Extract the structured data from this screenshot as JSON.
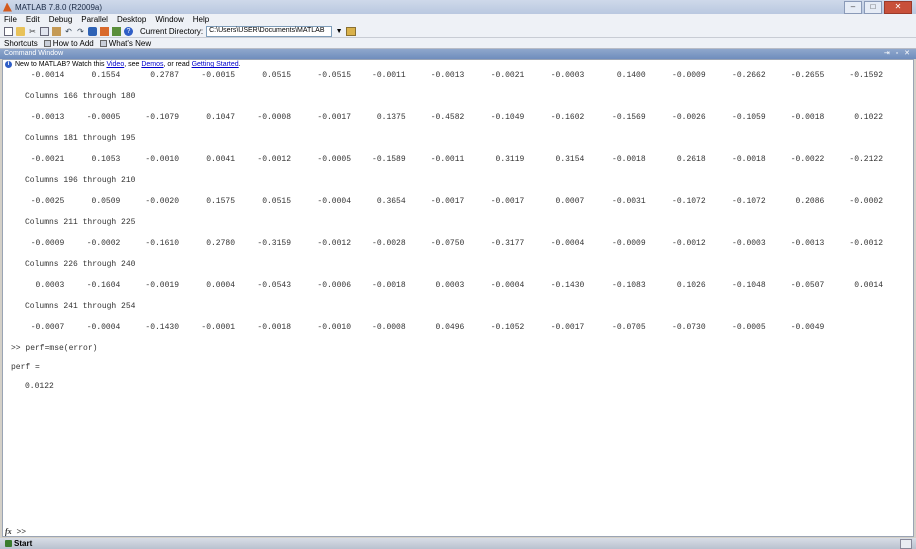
{
  "window": {
    "title": "MATLAB 7.8.0 (R2009a)",
    "minimize": "–",
    "maximize": "□",
    "close": "✕"
  },
  "menu": [
    "File",
    "Edit",
    "Debug",
    "Parallel",
    "Desktop",
    "Window",
    "Help"
  ],
  "toolbar": {
    "icons": [
      "new-file-icon",
      "open-folder-icon",
      "cut-icon",
      "copy-icon",
      "paste-icon",
      "undo-icon",
      "redo-icon",
      "simulink-icon",
      "guide-icon",
      "profiler-icon",
      "help-icon"
    ],
    "current_directory_label": "Current Directory:",
    "current_directory_value": "C:\\Users\\USER\\Documents\\MATLAB"
  },
  "shortcuts": {
    "label": "Shortcuts",
    "items": [
      "How to Add",
      "What's New"
    ]
  },
  "command_window": {
    "title": "Command Window",
    "info": {
      "prefix": "New to MATLAB? Watch this",
      "video": "Video",
      "mid1": ", see",
      "demos": "Demos",
      "mid2": ", or read",
      "getting_started": "Getting Started",
      "suffix": "."
    },
    "first_row": [
      "-0.0014",
      "0.1554",
      "0.2787",
      "-0.0015",
      "0.0515",
      "-0.0515",
      "-0.0011",
      "-0.0013",
      "-0.0021",
      "-0.0003",
      "0.1400",
      "-0.0009",
      "-0.2662",
      "-0.2655",
      "-0.1592"
    ],
    "blocks": [
      {
        "header": "Columns 166 through 180",
        "values": [
          "-0.0013",
          "-0.0005",
          "-0.1079",
          "0.1047",
          "-0.0008",
          "-0.0017",
          "0.1375",
          "-0.4582",
          "-0.1049",
          "-0.1602",
          "-0.1569",
          "-0.0026",
          "-0.1059",
          "-0.0018",
          "0.1022"
        ]
      },
      {
        "header": "Columns 181 through 195",
        "values": [
          "-0.0021",
          "0.1053",
          "-0.0010",
          "0.0041",
          "-0.0012",
          "-0.0005",
          "-0.1589",
          "-0.0011",
          "0.3119",
          "0.3154",
          "-0.0018",
          "0.2618",
          "-0.0018",
          "-0.0022",
          "-0.2122"
        ]
      },
      {
        "header": "Columns 196 through 210",
        "values": [
          "-0.0025",
          "0.0509",
          "-0.0020",
          "0.1575",
          "0.0515",
          "-0.0004",
          "0.3654",
          "-0.0017",
          "-0.0017",
          "0.0007",
          "-0.0031",
          "-0.1072",
          "-0.1072",
          "0.2086",
          "-0.0002"
        ]
      },
      {
        "header": "Columns 211 through 225",
        "values": [
          "-0.0009",
          "-0.0002",
          "-0.1610",
          "0.2780",
          "-0.3159",
          "-0.0012",
          "-0.0028",
          "-0.0750",
          "-0.3177",
          "-0.0004",
          "-0.0009",
          "-0.0012",
          "-0.0003",
          "-0.0013",
          "-0.0012"
        ]
      },
      {
        "header": "Columns 226 through 240",
        "values": [
          "0.0003",
          "-0.1604",
          "-0.0019",
          "0.0004",
          "-0.0543",
          "-0.0006",
          "-0.0018",
          "0.0003",
          "-0.0004",
          "-0.1430",
          "-0.1083",
          "0.1026",
          "-0.1048",
          "-0.0507",
          "0.0014"
        ]
      },
      {
        "header": "Columns 241 through 254",
        "values": [
          "-0.0007",
          "-0.0004",
          "-0.1430",
          "-0.0001",
          "-0.0018",
          "-0.0010",
          "-0.0008",
          "0.0496",
          "-0.1052",
          "-0.0017",
          "-0.0705",
          "-0.0730",
          "-0.0005",
          "-0.0049"
        ]
      }
    ],
    "command": ">> perf=mse(error)",
    "result_name": "perf =",
    "result_value": "0.0122",
    "prompt": ">>",
    "prompt_fx": "fx"
  },
  "taskbar": {
    "start": "Start"
  }
}
